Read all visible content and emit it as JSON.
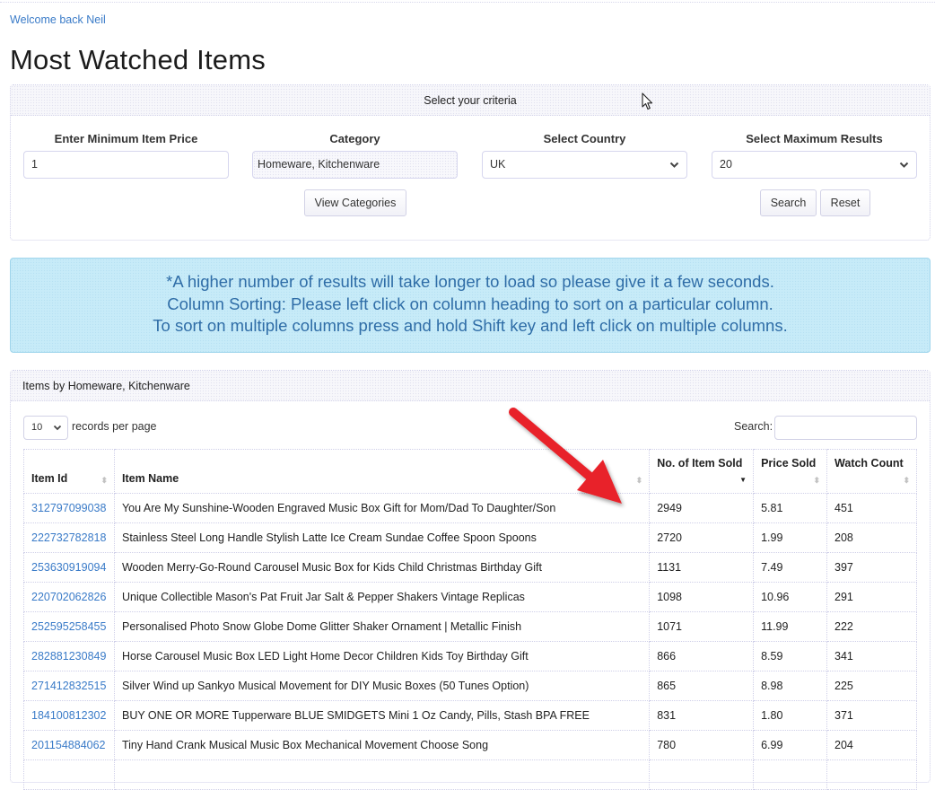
{
  "header": {
    "welcome": "Welcome back Neil",
    "title": "Most Watched Items"
  },
  "criteria": {
    "heading": "Select your criteria",
    "min_price": {
      "label": "Enter Minimum Item Price",
      "value": "1"
    },
    "category": {
      "label": "Category",
      "value": "Homeware, Kitchenware",
      "button": "View Categories"
    },
    "country": {
      "label": "Select Country",
      "selected": "UK"
    },
    "max_results": {
      "label": "Select Maximum Results",
      "selected": "20"
    },
    "search_button": "Search",
    "reset_button": "Reset"
  },
  "info": {
    "lines": [
      "*A higher number of results will take longer to load so please give it a few seconds.",
      "Column Sorting: Please left click on column heading to sort on a particular column.",
      "To sort on multiple columns press and hold Shift key and left click on multiple columns."
    ]
  },
  "results": {
    "heading": "Items by Homeware, Kitchenware",
    "page_length": "10",
    "page_length_label": "records per page",
    "search_label": "Search:",
    "search_value": "",
    "columns": [
      "Item Id",
      "Item Name",
      "No. of Item Sold",
      "Price Sold",
      "Watch Count"
    ],
    "sorted_column": "No. of Item Sold",
    "sort_direction": "descending",
    "rows": [
      {
        "id": "312797099038",
        "name": "You Are My Sunshine-Wooden Engraved Music Box Gift for Mom/Dad To Daughter/Son",
        "sold": "2949",
        "price": "5.81",
        "watch": "451"
      },
      {
        "id": "222732782818",
        "name": "Stainless Steel Long Handle Stylish Latte Ice Cream Sundae Coffee Spoon Spoons",
        "sold": "2720",
        "price": "1.99",
        "watch": "208"
      },
      {
        "id": "253630919094",
        "name": "Wooden Merry-Go-Round Carousel Music Box for Kids Child Christmas Birthday Gift",
        "sold": "1131",
        "price": "7.49",
        "watch": "397"
      },
      {
        "id": "220702062826",
        "name": "Unique Collectible Mason's Pat Fruit Jar Salt & Pepper Shakers Vintage Replicas",
        "sold": "1098",
        "price": "10.96",
        "watch": "291"
      },
      {
        "id": "252595258455",
        "name": "Personalised Photo Snow Globe Dome Glitter Shaker Ornament | Metallic Finish",
        "sold": "1071",
        "price": "11.99",
        "watch": "222"
      },
      {
        "id": "282881230849",
        "name": "Horse Carousel Music Box LED Light Home Decor Children Kids Toy Birthday Gift",
        "sold": "866",
        "price": "8.59",
        "watch": "341"
      },
      {
        "id": "271412832515",
        "name": "Silver Wind up Sankyo Musical Movement for DIY Music Boxes (50 Tunes Option)",
        "sold": "865",
        "price": "8.98",
        "watch": "225"
      },
      {
        "id": "184100812302",
        "name": "BUY ONE OR MORE Tupperware BLUE SMIDGETS Mini 1 Oz Candy, Pills, Stash BPA FREE",
        "sold": "831",
        "price": "1.80",
        "watch": "371"
      },
      {
        "id": "201154884062",
        "name": "Tiny Hand Crank Musical Music Box Mechanical Movement Choose Song",
        "sold": "780",
        "price": "6.99",
        "watch": "204"
      },
      {
        "id": "",
        "name": "",
        "sold": "",
        "price": "",
        "watch": ""
      }
    ]
  },
  "icons": {
    "select_chevron": "⌄",
    "sort_both": "⬍",
    "sort_desc": "▼"
  },
  "colors": {
    "link": "#3a7bc8",
    "info_bg": "#c7ebf8",
    "info_text": "#2f6da7",
    "annotation_arrow": "#e8232a"
  }
}
